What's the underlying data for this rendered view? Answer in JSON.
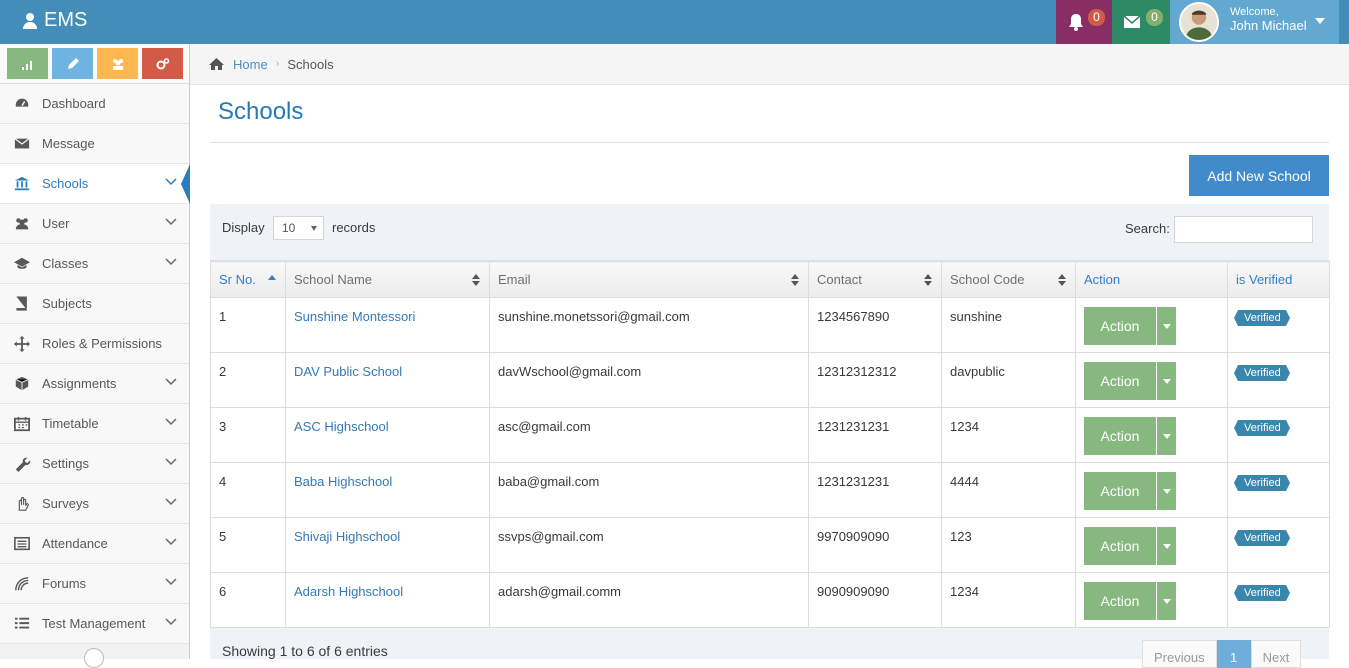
{
  "app": {
    "title": "EMS"
  },
  "navbar": {
    "notifications_count": "0",
    "messages_count": "0",
    "welcome_label": "Welcome,",
    "user_name": "John Michael"
  },
  "sidebar": {
    "items": [
      {
        "label": "Dashboard",
        "icon": "dashboard-icon",
        "has_submenu": false
      },
      {
        "label": "Message",
        "icon": "envelope-icon",
        "has_submenu": false
      },
      {
        "label": "Schools",
        "icon": "bank-icon",
        "has_submenu": true,
        "active": true
      },
      {
        "label": "User",
        "icon": "users-icon",
        "has_submenu": true
      },
      {
        "label": "Classes",
        "icon": "graduation-cap-icon",
        "has_submenu": true
      },
      {
        "label": "Subjects",
        "icon": "book-icon",
        "has_submenu": false
      },
      {
        "label": "Roles & Permissions",
        "icon": "arrows-icon",
        "has_submenu": false
      },
      {
        "label": "Assignments",
        "icon": "cube-icon",
        "has_submenu": true
      },
      {
        "label": "Timetable",
        "icon": "calendar-icon",
        "has_submenu": true
      },
      {
        "label": "Settings",
        "icon": "wrench-icon",
        "has_submenu": true
      },
      {
        "label": "Surveys",
        "icon": "hand-icon",
        "has_submenu": true
      },
      {
        "label": "Attendance",
        "icon": "list-alt-icon",
        "has_submenu": true
      },
      {
        "label": "Forums",
        "icon": "signal-icon",
        "has_submenu": true
      },
      {
        "label": "Test Management",
        "icon": "list-icon",
        "has_submenu": true
      }
    ]
  },
  "breadcrumb": {
    "home": "Home",
    "current": "Schools"
  },
  "page": {
    "title": "Schools",
    "add_button": "Add New School"
  },
  "table_controls": {
    "display_label": "Display",
    "page_size": "10",
    "records_label": "records",
    "search_label": "Search:",
    "search_value": ""
  },
  "table": {
    "columns": [
      "Sr No.",
      "School Name",
      "Email",
      "Contact",
      "School Code",
      "Action",
      "is Verified"
    ],
    "rows": [
      {
        "sr": "1",
        "name": "Sunshine Montessori",
        "email": "sunshine.monetssori@gmail.com",
        "contact": "1234567890",
        "code": "sunshine",
        "action": "Action",
        "verified": "Verified"
      },
      {
        "sr": "2",
        "name": "DAV Public School",
        "email": "davWschool@gmail.com",
        "contact": "12312312312",
        "code": "davpublic",
        "action": "Action",
        "verified": "Verified"
      },
      {
        "sr": "3",
        "name": "ASC Highschool",
        "email": "asc@gmail.com",
        "contact": "1231231231",
        "code": "1234",
        "action": "Action",
        "verified": "Verified"
      },
      {
        "sr": "4",
        "name": "Baba Highschool",
        "email": "baba@gmail.com",
        "contact": "1231231231",
        "code": "4444",
        "action": "Action",
        "verified": "Verified"
      },
      {
        "sr": "5",
        "name": "Shivaji Highschool",
        "email": "ssvps@gmail.com",
        "contact": "9970909090",
        "code": "123",
        "action": "Action",
        "verified": "Verified"
      },
      {
        "sr": "6",
        "name": "Adarsh Highschool",
        "email": "adarsh@gmail.comm",
        "contact": "9090909090",
        "code": "1234",
        "action": "Action",
        "verified": "Verified"
      }
    ]
  },
  "footer": {
    "info": "Showing 1 to 6 of 6 entries",
    "prev": "Previous",
    "current_page": "1",
    "next": "Next"
  },
  "colors": {
    "navbar": "#438eb9",
    "accent_blue": "#2679b5",
    "action_green": "#87b87f",
    "verified_blue": "#3a87ad"
  }
}
